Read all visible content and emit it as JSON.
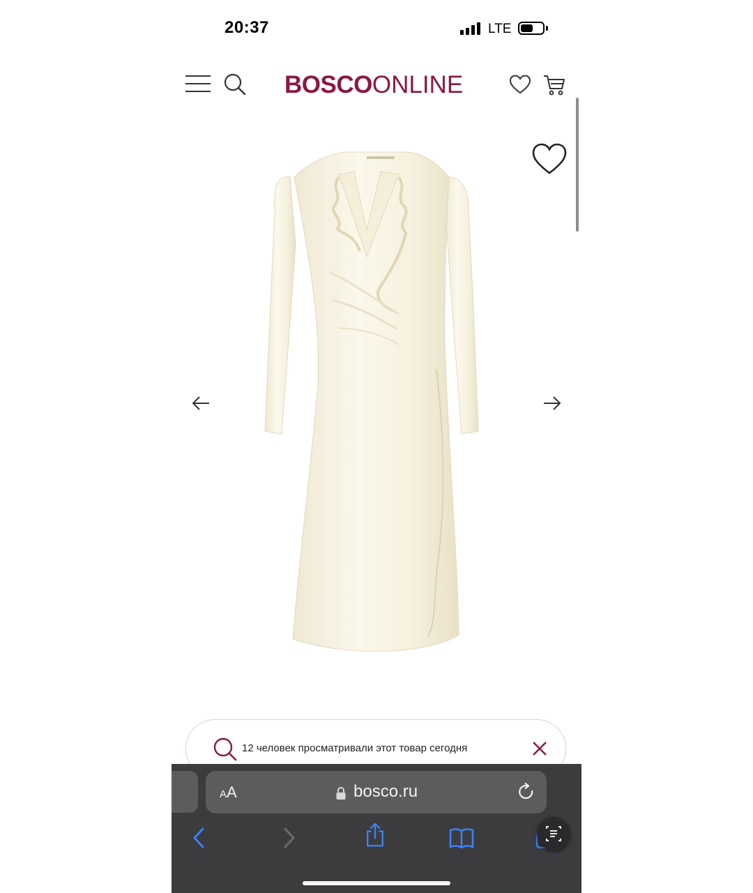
{
  "status_bar": {
    "time": "20:37",
    "network": "LTE",
    "battery_level": 0.55
  },
  "header": {
    "logo_bold": "BOSCO",
    "logo_light": "ONLINE",
    "brand_color": "#8c1841",
    "icons": [
      "menu-icon",
      "search-icon",
      "heart-icon",
      "cart-icon"
    ]
  },
  "product": {
    "favorite_icon": "heart-outline-icon",
    "image_description_icon": "dress-image",
    "prev_icon": "arrow-left-icon",
    "next_icon": "arrow-right-icon"
  },
  "notice": {
    "text": "12 человек просматривали этот товар сегодня",
    "icon": "search-icon",
    "close_icon": "close-icon",
    "accent_color": "#8c1841"
  },
  "browser": {
    "text_size_small": "A",
    "text_size_large": "A",
    "url": "bosco.ru",
    "lock_icon": "lock-icon",
    "reload_icon": "reload-icon",
    "toolbar_icons": [
      "back-icon",
      "forward-icon",
      "share-icon",
      "bookmarks-icon",
      "tabs-icon"
    ],
    "reader_icon": "reader-icon",
    "accent_color": "#3b82f6"
  }
}
